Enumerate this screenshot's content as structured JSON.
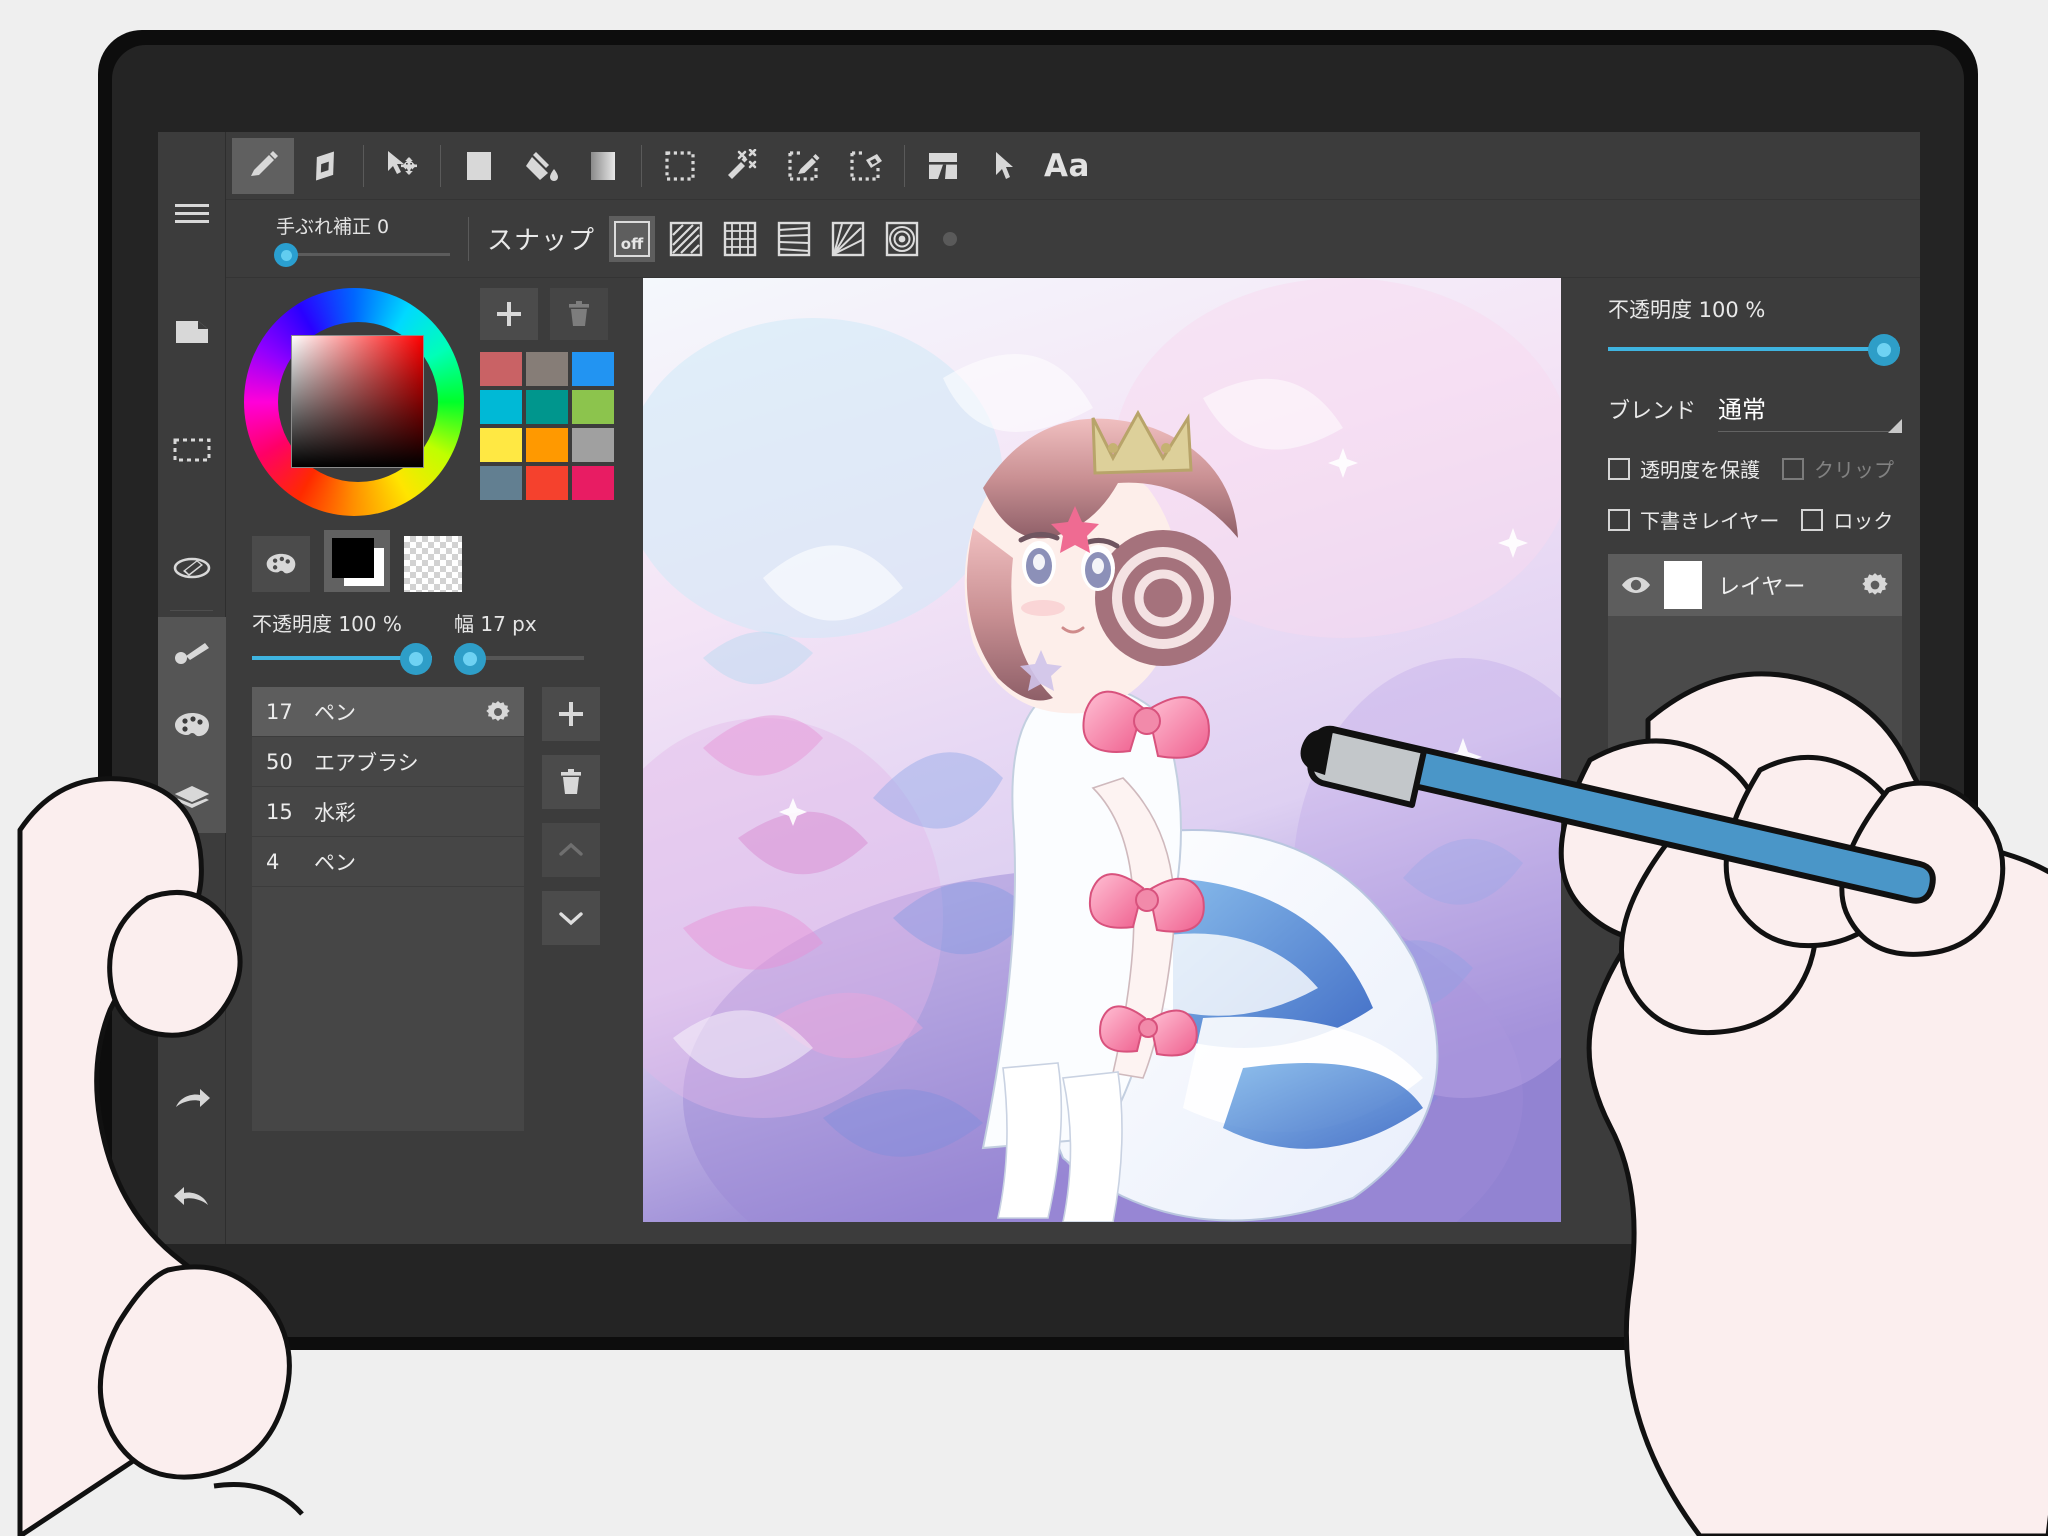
{
  "app": {
    "name": "medibang-paint-tablet-ui"
  },
  "rail": {
    "items": [
      {
        "name": "menu",
        "icon": "hamburger-menu-icon",
        "active": false
      },
      {
        "name": "file",
        "icon": "file-page-icon",
        "active": false
      },
      {
        "name": "select",
        "icon": "selection-marquee-icon",
        "active": false
      },
      {
        "name": "transform",
        "icon": "flip-transform-icon",
        "active": false
      },
      {
        "name": "brush",
        "icon": "brush-icon",
        "active": true
      },
      {
        "name": "palette",
        "icon": "palette-icon",
        "active": true
      },
      {
        "name": "layers",
        "icon": "layers-icon",
        "active": true
      }
    ],
    "bottom": [
      {
        "name": "redo",
        "icon": "redo-arrow-icon"
      },
      {
        "name": "undo",
        "icon": "undo-arrow-icon"
      }
    ]
  },
  "toolbar": {
    "tools": [
      {
        "name": "pen",
        "icon": "pencil-icon",
        "active": true
      },
      {
        "name": "eraser",
        "icon": "eraser-icon",
        "active": false
      },
      {
        "name": "move",
        "icon": "move-cursor-icon",
        "active": false
      },
      {
        "name": "fill-rect",
        "icon": "filled-square-icon",
        "active": false
      },
      {
        "name": "bucket",
        "icon": "paint-bucket-icon",
        "active": false
      },
      {
        "name": "gradient",
        "icon": "gradient-square-icon",
        "active": false
      },
      {
        "name": "select-rect",
        "icon": "dotted-square-icon",
        "active": false
      },
      {
        "name": "magic-wand",
        "icon": "magic-wand-icon",
        "active": false
      },
      {
        "name": "select-pen",
        "icon": "select-pen-icon",
        "active": false
      },
      {
        "name": "select-eraser",
        "icon": "select-eraser-icon",
        "active": false
      },
      {
        "name": "divide",
        "icon": "divide-panel-icon",
        "active": false
      },
      {
        "name": "operation",
        "icon": "arrow-cursor-icon",
        "active": false
      },
      {
        "name": "text",
        "icon": "text-aa-icon",
        "label": "Aa",
        "active": false
      }
    ]
  },
  "options": {
    "stabilizer_label": "手ぶれ補正  0",
    "stabilizer_value": 0,
    "snap_label": "スナップ",
    "snap_modes": [
      {
        "name": "off",
        "label": "off",
        "active": true
      },
      {
        "name": "parallel-lines",
        "label": "",
        "active": false
      },
      {
        "name": "grid",
        "label": "",
        "active": false
      },
      {
        "name": "horizontal",
        "label": "",
        "active": false
      },
      {
        "name": "radial",
        "label": "",
        "active": false
      },
      {
        "name": "concentric",
        "label": "",
        "active": false
      }
    ]
  },
  "color_panel": {
    "add_label": "+",
    "swatches": [
      "#c96265",
      "#867d77",
      "#2294f2",
      "#00b9d6",
      "#00968d",
      "#8cc44d",
      "#ffe843",
      "#ff9900",
      "#a0a0a0",
      "#627f91",
      "#f5412d",
      "#e81c63"
    ],
    "foreground": "#000000",
    "background": "#ffffff",
    "opacity_label": "不透明度 100 %",
    "opacity_value": 100,
    "width_label": "幅 17 px",
    "width_value": 17
  },
  "brushes": {
    "items": [
      {
        "size": "17",
        "name": "ペン",
        "selected": true
      },
      {
        "size": "50",
        "name": "エアブラシ",
        "selected": false
      },
      {
        "size": "15",
        "name": "水彩",
        "selected": false
      },
      {
        "size": "4",
        "name": "ペン",
        "selected": false
      }
    ],
    "buttons": [
      {
        "name": "add-brush",
        "icon": "plus-icon",
        "enabled": true
      },
      {
        "name": "delete-brush",
        "icon": "trash-icon",
        "enabled": true
      },
      {
        "name": "move-brush-up",
        "icon": "chevron-up-icon",
        "enabled": false
      },
      {
        "name": "move-brush-down",
        "icon": "chevron-down-icon",
        "enabled": true
      }
    ]
  },
  "layer_panel": {
    "opacity_label": "不透明度 100 %",
    "opacity_value": 100,
    "blend_key": "ブレンド",
    "blend_value": "通常",
    "checkboxes": [
      {
        "name": "protect-alpha",
        "label": "透明度を保護",
        "checked": false,
        "enabled": true
      },
      {
        "name": "clipping",
        "label": "クリップ",
        "checked": false,
        "enabled": false
      },
      {
        "name": "draft-layer",
        "label": "下書きレイヤー",
        "checked": false,
        "enabled": true
      },
      {
        "name": "lock",
        "label": "ロック",
        "checked": false,
        "enabled": true
      }
    ],
    "layers": [
      {
        "name": "レイヤー",
        "visible": true
      }
    ],
    "footer_buttons": [
      {
        "name": "add-layer",
        "icon": "plus-icon",
        "enabled": true
      },
      {
        "name": "delete-layer",
        "icon": "trash-icon",
        "enabled": false
      },
      {
        "name": "duplicate-layer",
        "icon": "copy-icon",
        "enabled": true
      }
    ]
  },
  "colors": {
    "accent": "#2e9ec8",
    "accent_light": "#6ed2f3",
    "panel_bg": "#3c3c3c",
    "panel_bg_light": "#4b4b4b",
    "selected_row": "#5d5d5d",
    "text": "#e9e9e9",
    "tablet_bezel": "#0d0d0d",
    "desk_bg": "#efefef",
    "stylus_body": "#4a96c8",
    "stylus_tip": "#c3c7ca",
    "skin": "#fbeeee"
  },
  "canvas": {
    "artwork_description": "anime-illustration-girl-with-crown"
  }
}
